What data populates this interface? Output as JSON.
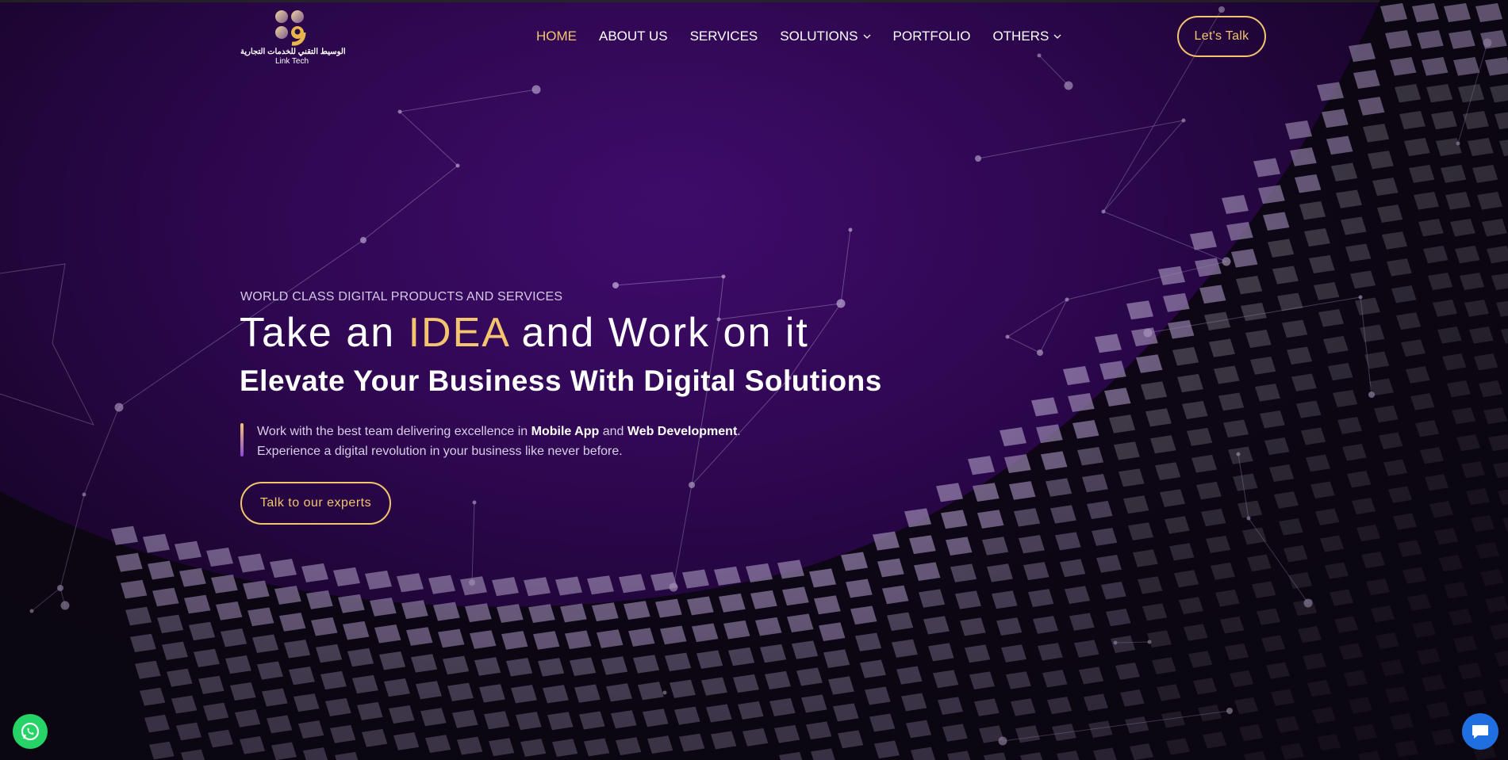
{
  "brand": {
    "name_ar": "الوسيط التقني للخدمات التجارية",
    "name_en": "Link Tech",
    "gold": "#f4c56e",
    "purple": "#3f0c6c"
  },
  "nav": {
    "items": [
      {
        "label": "HOME",
        "active": true,
        "dropdown": false
      },
      {
        "label": "ABOUT US",
        "active": false,
        "dropdown": false
      },
      {
        "label": "SERVICES",
        "active": false,
        "dropdown": false
      },
      {
        "label": "SOLUTIONS",
        "active": false,
        "dropdown": true
      },
      {
        "label": "PORTFOLIO",
        "active": false,
        "dropdown": false
      },
      {
        "label": "OTHERS",
        "active": false,
        "dropdown": true
      }
    ],
    "cta_label": "Let's Talk"
  },
  "hero": {
    "eyebrow": "WORLD CLASS DIGITAL PRODUCTS AND SERVICES",
    "headline_pre": "Take an ",
    "headline_highlight": "IDEA",
    "headline_post": " and Work on it",
    "subhead": "Elevate Your Business With Digital Solutions",
    "desc_line1_pre": "Work with the best team delivering excellence in ",
    "desc_bold1": "Mobile App",
    "desc_mid": " and ",
    "desc_bold2": "Web Development",
    "desc_end": ".",
    "desc_line2": "Experience a digital revolution in your business like never before.",
    "cta_label": "Talk to our experts"
  },
  "floating": {
    "whatsapp_icon": "whatsapp-icon",
    "chat_icon": "chat-bubble-icon"
  }
}
